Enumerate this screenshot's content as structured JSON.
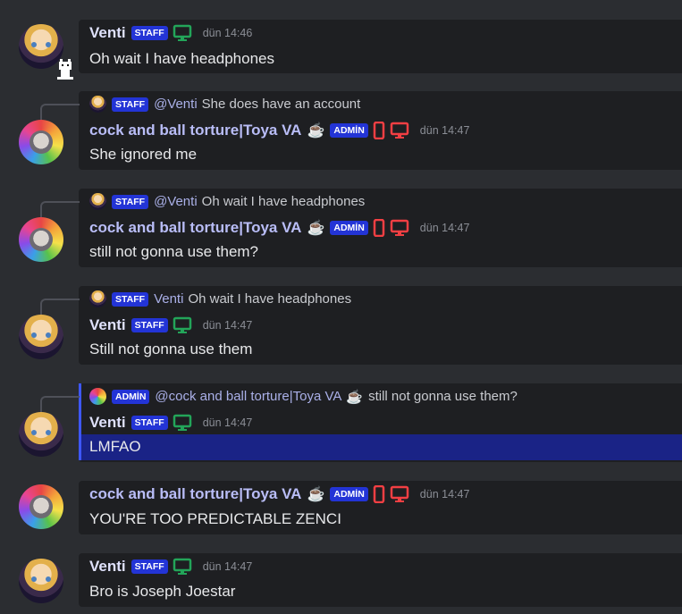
{
  "users": {
    "venti": {
      "name": "Venti",
      "tag": "STAFF"
    },
    "toya": {
      "name": "cock and ball torture|Toya VA",
      "tag": "ADMİN"
    }
  },
  "messages": [
    {
      "time": "dün 14:46",
      "text": "Oh wait I have headphones"
    },
    {
      "time": "dün 14:47",
      "text": "She ignored me",
      "reply": {
        "tag": "STAFF",
        "mention": "@Venti",
        "text": "She does have an account"
      }
    },
    {
      "time": "dün 14:47",
      "text": "still not gonna use them?",
      "reply": {
        "tag": "STAFF",
        "mention": "@Venti",
        "text": "Oh wait I have headphones"
      }
    },
    {
      "time": "dün 14:47",
      "text": "Still not gonna use them",
      "reply": {
        "tag": "STAFF",
        "mention": "Venti",
        "text": "Oh wait I have headphones"
      }
    },
    {
      "time": "dün 14:47",
      "text": "LMFAO",
      "reply": {
        "tag": "ADMİN",
        "mention": "@cock and ball torture|Toya VA",
        "text": "still not gonna use them?"
      }
    },
    {
      "time": "dün 14:47",
      "text": "YOU'RE TOO PREDICTABLE ZENCI"
    },
    {
      "time": "dün 14:47",
      "text": "Bro is Joseph Joestar"
    }
  ],
  "icons": {
    "desktop_online": "desktop-icon",
    "mobile_dnd": "mobile-icon",
    "desktop_dnd": "desktop-icon",
    "coffee": "coffee-emoji"
  },
  "colors": {
    "background": "#2b2d31",
    "bubble": "#1e1f22",
    "tag": "#2334d6",
    "online": "#23a559",
    "dnd": "#f23f43",
    "highlight": "#1a2386"
  }
}
